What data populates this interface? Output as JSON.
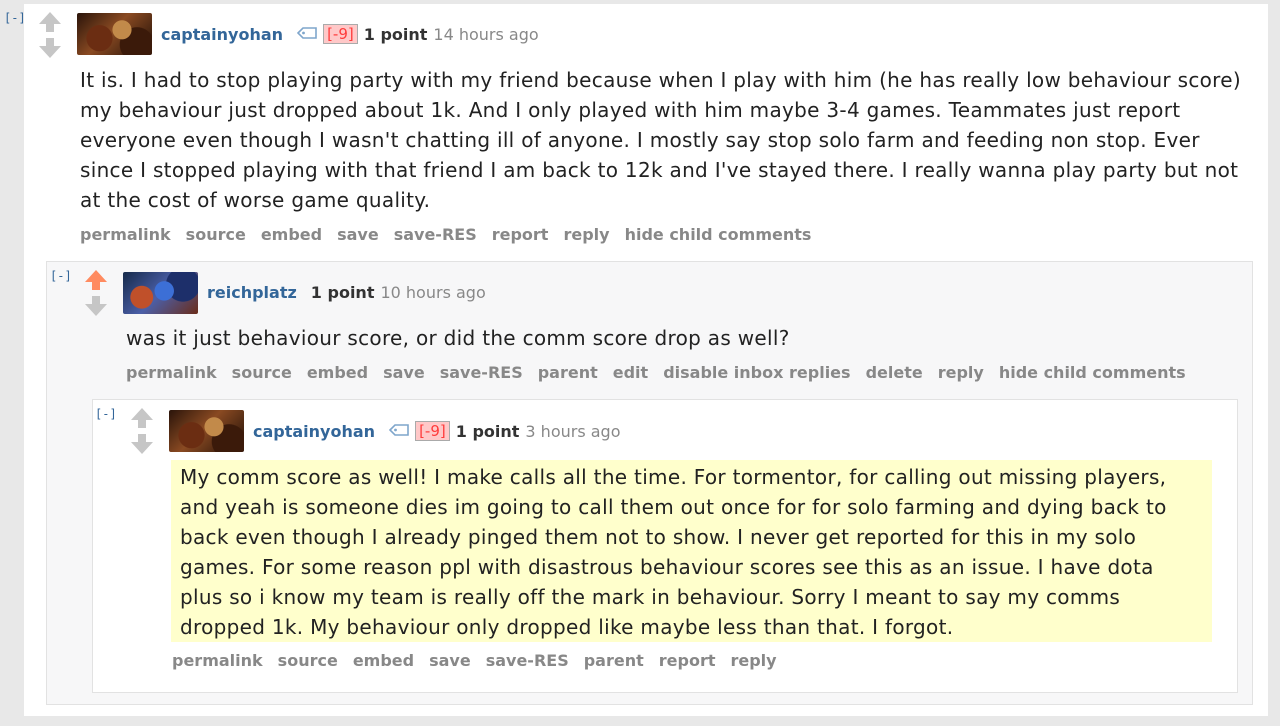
{
  "colors": {
    "link_blue": "#336699",
    "upvote_orange": "#ff8b60",
    "neutral_arrow": "#c6c6c6",
    "flair_red": "#ff3c3c",
    "flair_bg": "#ffc8c8",
    "highlight_bg": "#ffffcc"
  },
  "comments": [
    {
      "collapse": "[-]",
      "author": "captainyohan",
      "flair": "[-9]",
      "score": "1 point",
      "time": "14 hours ago",
      "body": "It is. I had to stop playing party with my friend because when I play with him (he has really low behaviour score) my behaviour just dropped about 1k. And I only played with him maybe 3-4 games. Teammates just report everyone even though I wasn't chatting ill of anyone. I mostly say stop solo farm and feeding non stop. Ever since I stopped playing with that friend I am back to 12k and I've stayed there. I really wanna play party but not at the cost of worse game quality.",
      "actions": [
        "permalink",
        "source",
        "embed",
        "save",
        "save-RES",
        "report",
        "reply",
        "hide child comments"
      ]
    },
    {
      "collapse": "[-]",
      "author": "reichplatz",
      "score": "1 point",
      "time": "10 hours ago",
      "upvoted": true,
      "body": "was it just behaviour score, or did the comm score drop as well?",
      "actions": [
        "permalink",
        "source",
        "embed",
        "save",
        "save-RES",
        "parent",
        "edit",
        "disable inbox replies",
        "delete",
        "reply",
        "hide child comments"
      ]
    },
    {
      "collapse": "[-]",
      "author": "captainyohan",
      "flair": "[-9]",
      "score": "1 point",
      "time": "3 hours ago",
      "highlighted": true,
      "body": "My comm score as well! I make calls all the time. For tormentor, for calling out missing players, and yeah is someone dies im going to call them out once for for solo farming and dying back to back even though I already pinged them not to show. I never get reported for this in my solo games. For some reason ppl with disastrous behaviour scores see this as an issue. I have dota plus so i know my team is really off the mark in behaviour. Sorry I meant to say my comms dropped 1k. My behaviour only dropped like maybe less than that. I forgot.",
      "actions": [
        "permalink",
        "source",
        "embed",
        "save",
        "save-RES",
        "parent",
        "report",
        "reply"
      ]
    }
  ]
}
